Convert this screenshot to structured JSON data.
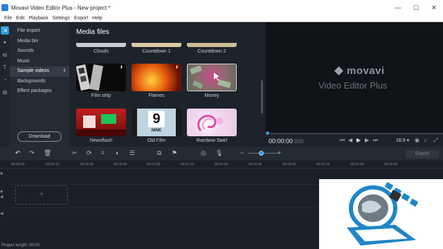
{
  "window": {
    "title": "Movavi Video Editor Plus - New project *"
  },
  "menu": [
    "File",
    "Edit",
    "Playback",
    "Settings",
    "Export",
    "Help"
  ],
  "import_sidebar": {
    "items": [
      "File import",
      "Media bin",
      "Sounds",
      "Music",
      "Sample videos",
      "Backgrounds",
      "Effect packages"
    ],
    "selected": "Sample videos",
    "download_label": "Download"
  },
  "media": {
    "title": "Media files",
    "top_row": [
      "Clouds",
      "Countdown 1",
      "Countdown 2"
    ],
    "grid": [
      {
        "label": "Film strip",
        "color": "#e6e6e6"
      },
      {
        "label": "Flames",
        "color": "#c8320a"
      },
      {
        "label": "Money",
        "color": "#7a5a66"
      },
      {
        "label": "Newsflash",
        "color": "#8b1414"
      },
      {
        "label": "Old Film",
        "color": "#bfd3e0"
      },
      {
        "label": "Rainbow Swirl",
        "color": "#f0e6ef"
      }
    ],
    "old_film_digit": "9",
    "old_film_caption": "NINE"
  },
  "preview": {
    "brand": "movavi",
    "product": "Video Editor Plus",
    "timecode_main": "00:00:00",
    "timecode_ms": ".000",
    "aspect_ratio": "16:9 ▾"
  },
  "timeline": {
    "export_label": "Export",
    "ruler_ticks": [
      "00:00:00",
      "00:00:15",
      "00:00:30",
      "00:00:45",
      "00:01:00",
      "00:01:15",
      "00:01:30",
      "00:01:45",
      "00:02:00",
      "00:02:15",
      "00:02:30",
      "00:02:45"
    ],
    "add_symbol": "+"
  },
  "status": {
    "project_length": "Project length: 00:00"
  },
  "colors": {
    "accent": "#2f9bd6",
    "overlay_blue": "#1f86c9"
  }
}
